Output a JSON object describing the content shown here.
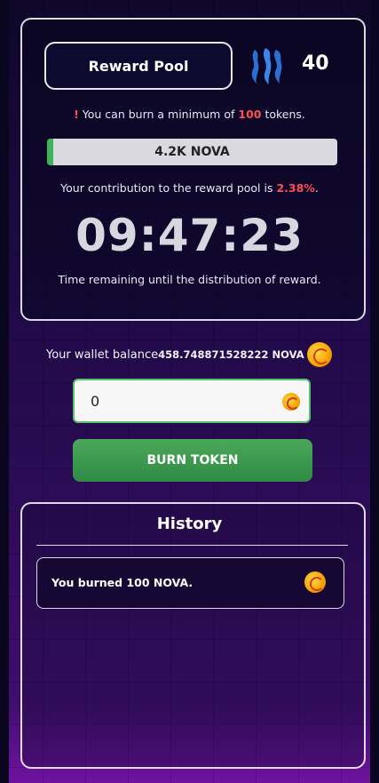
{
  "reward_pool": {
    "title": "Reward Pool",
    "participant_count": "40",
    "min_note_prefix": "You can burn a minimum of",
    "min_amount": "100",
    "min_note_suffix": "tokens.",
    "progress_label": "4.2K NOVA",
    "progress_fraction": 0.02,
    "contribution_prefix": "Your contribution to the reward pool is",
    "contribution_percent": "2.38%",
    "timer": "09:47:23",
    "timer_note": "Time remaining until the distribution of reward."
  },
  "wallet": {
    "label": "Your wallet balance",
    "value": "458.748871528222 NOVA"
  },
  "burn": {
    "input_value": "0",
    "button_label": "BURN TOKEN"
  },
  "history": {
    "title": "History",
    "items": [
      {
        "text": "You burned 100 NOVA."
      }
    ]
  },
  "colors": {
    "accent_green": "#3fb35a",
    "alert_red": "#ff4f55",
    "coin_gold": "#f5a300"
  },
  "icons": [
    "exclamation-icon",
    "steem-logo-icon",
    "nova-coin-icon"
  ]
}
